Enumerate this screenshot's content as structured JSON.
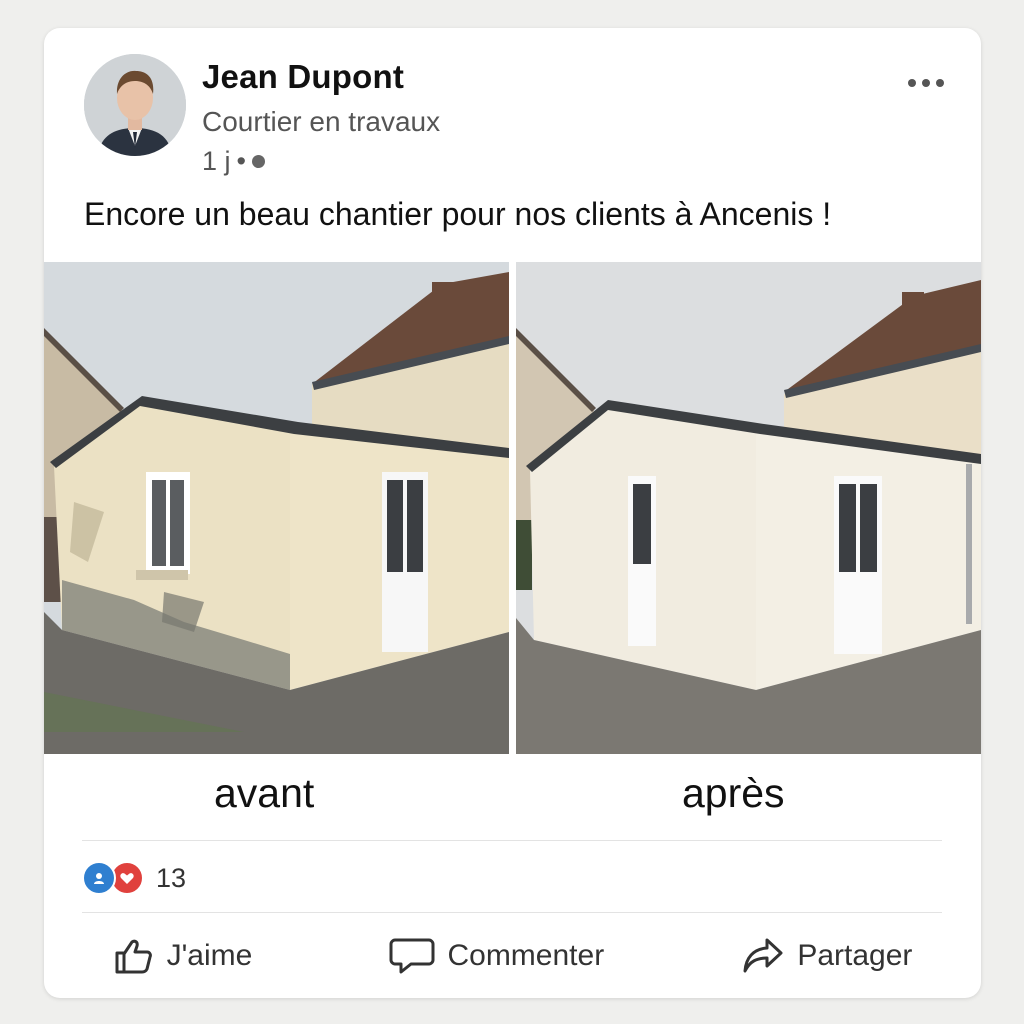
{
  "post": {
    "author": {
      "name": "Jean Dupont",
      "title": "Courtier en travaux",
      "time": "1 j",
      "separator": "•"
    },
    "text": "Encore un beau chantier pour nos clients à Ancenis !",
    "images": {
      "before_label": "avant",
      "after_label": "après"
    },
    "reactions": {
      "count": "13",
      "types": [
        "like-icon",
        "heart-icon"
      ]
    },
    "actions": {
      "like_label": "J'aime",
      "comment_label": "Commenter",
      "share_label": "Partager"
    }
  },
  "colors": {
    "like": "#2f7fd0",
    "love": "#e0413d"
  }
}
